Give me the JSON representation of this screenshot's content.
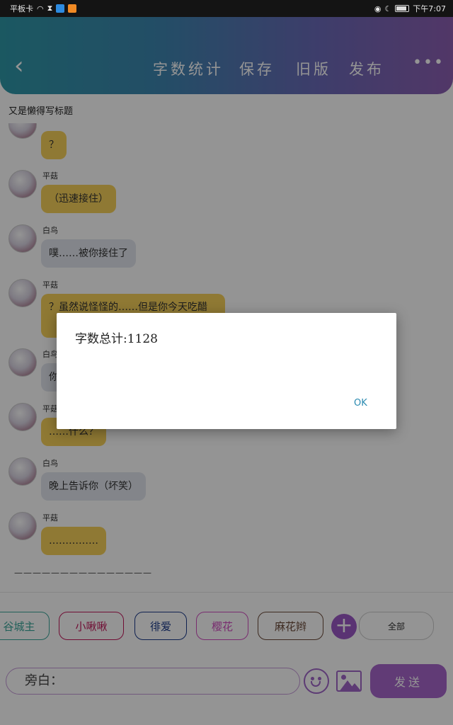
{
  "status_bar": {
    "left": "平板卡",
    "time": "下午7:07"
  },
  "header": {
    "nav": [
      "字数统计",
      "保存",
      "旧版",
      "发布"
    ],
    "more": "•••"
  },
  "document": {
    "title": "又是懒得写标题"
  },
  "messages": [
    {
      "name": "",
      "text": "？",
      "style": "yellow"
    },
    {
      "name": "平菇",
      "text": "（迅速接住）",
      "style": "yellow"
    },
    {
      "name": "白鸟",
      "text": "噗……被你接住了",
      "style": "gray"
    },
    {
      "name": "平菇",
      "text": "？虽然说怪怪的……但是你今天吃醋",
      "style": "yellow"
    },
    {
      "name": "白鸟",
      "text": "你",
      "style": "gray"
    },
    {
      "name": "平菇",
      "text": "……什么？",
      "style": "yellow"
    },
    {
      "name": "白鸟",
      "text": "晚上告诉你（坏笑）",
      "style": "gray"
    },
    {
      "name": "平菇",
      "text": "……………",
      "style": "yellow"
    }
  ],
  "divider": "———————————————",
  "tags": [
    {
      "label": "谷城主",
      "color": "#3aa59a"
    },
    {
      "label": "小啾啾",
      "color": "#c2185b"
    },
    {
      "label": "徘爱",
      "color": "#1a3a8a"
    },
    {
      "label": "樱花",
      "color": "#d04cbf"
    },
    {
      "label": "麻花辫",
      "color": "#6b4a3a"
    }
  ],
  "tag_add_label": "+",
  "tag_all_label": "全部",
  "input": {
    "placeholder": "旁白："
  },
  "send_label": "发送",
  "dialog": {
    "message": "字数总计:1128",
    "ok_label": "OK"
  },
  "colors": {
    "accent": "#a866cc",
    "header_start": "#2f98a8",
    "header_end": "#8d5fb2"
  }
}
